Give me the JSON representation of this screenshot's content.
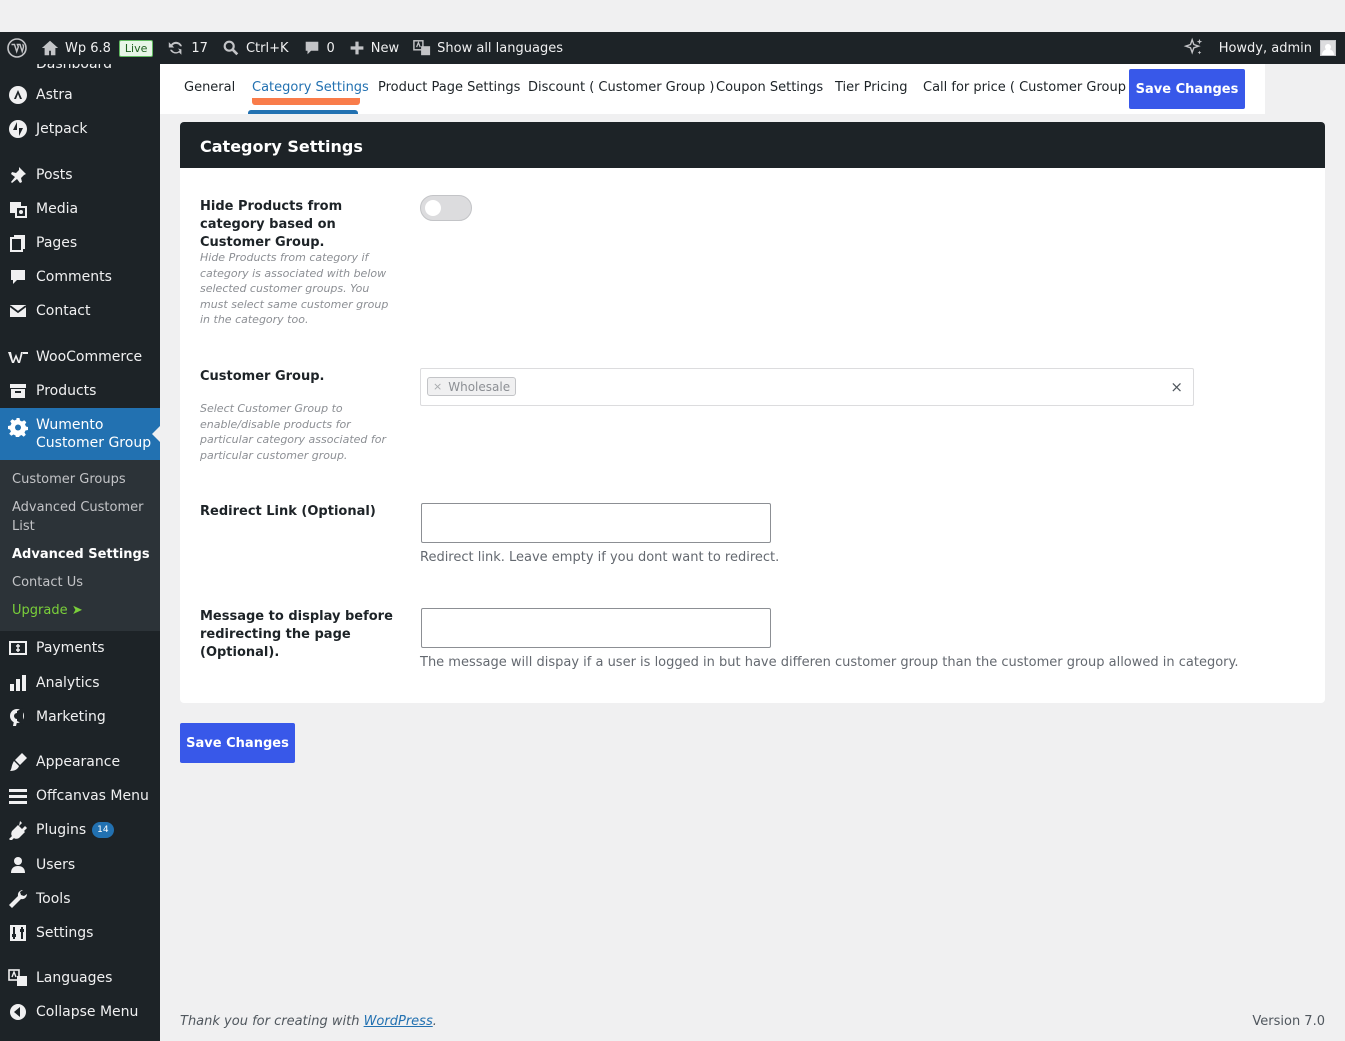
{
  "adminbar": {
    "site_name": "Wp 6.8",
    "live": "Live",
    "updates_count": "17",
    "shortcut": "Ctrl+K",
    "comments_count": "0",
    "new_label": "New",
    "languages_label": "Show all languages",
    "howdy": "Howdy, admin"
  },
  "sidebar": {
    "cut_item": "Dashboard",
    "astra": "Astra",
    "jetpack": "Jetpack",
    "posts": "Posts",
    "media": "Media",
    "pages": "Pages",
    "comments": "Comments",
    "contact": "Contact",
    "woocommerce": "WooCommerce",
    "products": "Products",
    "wumento_line1": "Wumento",
    "wumento_line2": "Customer Group",
    "sub": {
      "customer_groups": "Customer Groups",
      "advanced_customer_list": "Advanced Customer List",
      "advanced_settings": "Advanced Settings",
      "contact_us": "Contact Us",
      "upgrade": "Upgrade ➤"
    },
    "payments": "Payments",
    "analytics": "Analytics",
    "marketing": "Marketing",
    "appearance": "Appearance",
    "offcanvas": "Offcanvas Menu",
    "plugins": "Plugins",
    "plugins_badge": "14",
    "users": "Users",
    "tools": "Tools",
    "settings": "Settings",
    "languages": "Languages",
    "collapse": "Collapse Menu"
  },
  "tabs": {
    "general": "General",
    "category_settings": "Category Settings",
    "product_page_settings": "Product Page Settings",
    "discount": "Discount ( Customer Group )",
    "coupon": "Coupon Settings",
    "tier": "Tier Pricing",
    "call_for_price": "Call for price ( Customer Group )",
    "save": "Save Changes"
  },
  "card": {
    "title": "Category Settings",
    "hide_label": "Hide Products from category based on Customer Group.",
    "hide_desc": "Hide Products from category if category is associated with below selected customer groups. You must select same customer group in the category too.",
    "hide_enabled": false,
    "group_label": "Customer Group.",
    "group_desc": "Select Customer Group to enable/disable products for particular category associated for particular customer group.",
    "group_selected": "Wholesale",
    "chip_remove": "×",
    "clear": "×",
    "redirect_label": "Redirect Link (Optional)",
    "redirect_value": "",
    "redirect_help": "Redirect link. Leave empty if you dont want to redirect.",
    "message_label": "Message to display before redirecting the page (Optional).",
    "message_value": "",
    "message_help": "The message will dispay if a user is logged in but have differen customer group than the customer group allowed in category."
  },
  "save_bottom": "Save Changes",
  "footer": {
    "thanks_prefix": "Thank you for creating with ",
    "wp_link": "WordPress",
    "thanks_suffix": ".",
    "version": "Version 7.0"
  },
  "colors": {
    "adminbar_bg": "#1d2327",
    "accent": "#2271b1",
    "button": "#3858e9",
    "tab_highlight": "#f97c4a"
  }
}
